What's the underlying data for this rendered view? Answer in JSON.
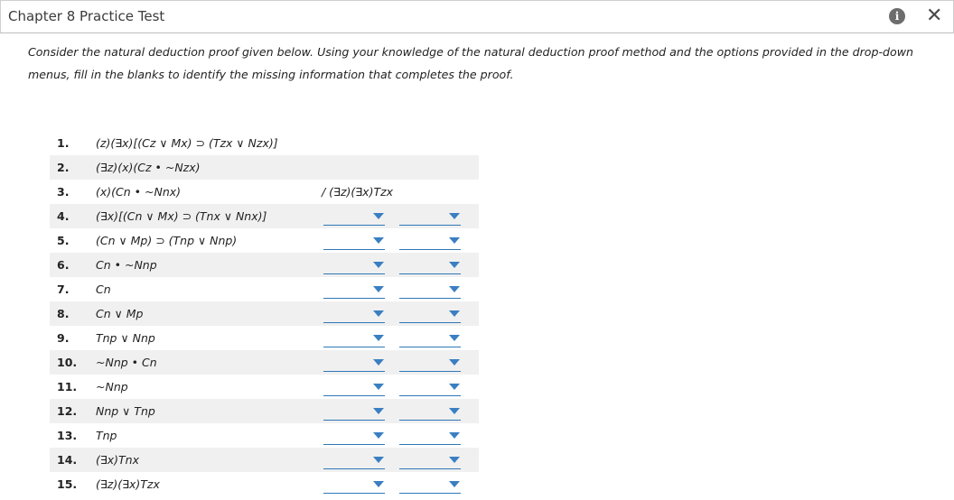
{
  "title": "Chapter 8 Practice Test",
  "icons": {
    "info": "info-icon",
    "close": "close-icon"
  },
  "instructions": "Consider the natural deduction proof given below. Using your knowledge of the natural deduction proof method and the options provided in the drop-down menus, fill in the blanks to identify the missing information that completes the proof.",
  "conclusion": "/ (∃z)(∃x)Tzx",
  "accent_color": "#3a7fc2",
  "lines": [
    {
      "num": "1.",
      "formula": "(z)(∃x)[(Cz ∨ Mx) ⊃ (Tzx ∨ Nzx)]",
      "dropdowns": false
    },
    {
      "num": "2.",
      "formula": "(∃z)(x)(Cz • ~Nzx)",
      "dropdowns": false
    },
    {
      "num": "3.",
      "formula": "(x)(Cn • ~Nnx)",
      "dropdowns": false
    },
    {
      "num": "4.",
      "formula": "(∃x)[(Cn ∨ Mx) ⊃ (Tnx ∨ Nnx)]",
      "dropdowns": true
    },
    {
      "num": "5.",
      "formula": "(Cn ∨ Mp) ⊃ (Tnp ∨ Nnp)",
      "dropdowns": true
    },
    {
      "num": "6.",
      "formula": "Cn • ~Nnp",
      "dropdowns": true
    },
    {
      "num": "7.",
      "formula": "Cn",
      "dropdowns": true
    },
    {
      "num": "8.",
      "formula": "Cn ∨ Mp",
      "dropdowns": true
    },
    {
      "num": "9.",
      "formula": "Tnp ∨ Nnp",
      "dropdowns": true
    },
    {
      "num": "10.",
      "formula": "~Nnp • Cn",
      "dropdowns": true
    },
    {
      "num": "11.",
      "formula": "~Nnp",
      "dropdowns": true
    },
    {
      "num": "12.",
      "formula": "Nnp ∨ Tnp",
      "dropdowns": true
    },
    {
      "num": "13.",
      "formula": "Tnp",
      "dropdowns": true
    },
    {
      "num": "14.",
      "formula": "(∃x)Tnx",
      "dropdowns": true
    },
    {
      "num": "15.",
      "formula": "(∃z)(∃x)Tzx",
      "dropdowns": true
    }
  ]
}
